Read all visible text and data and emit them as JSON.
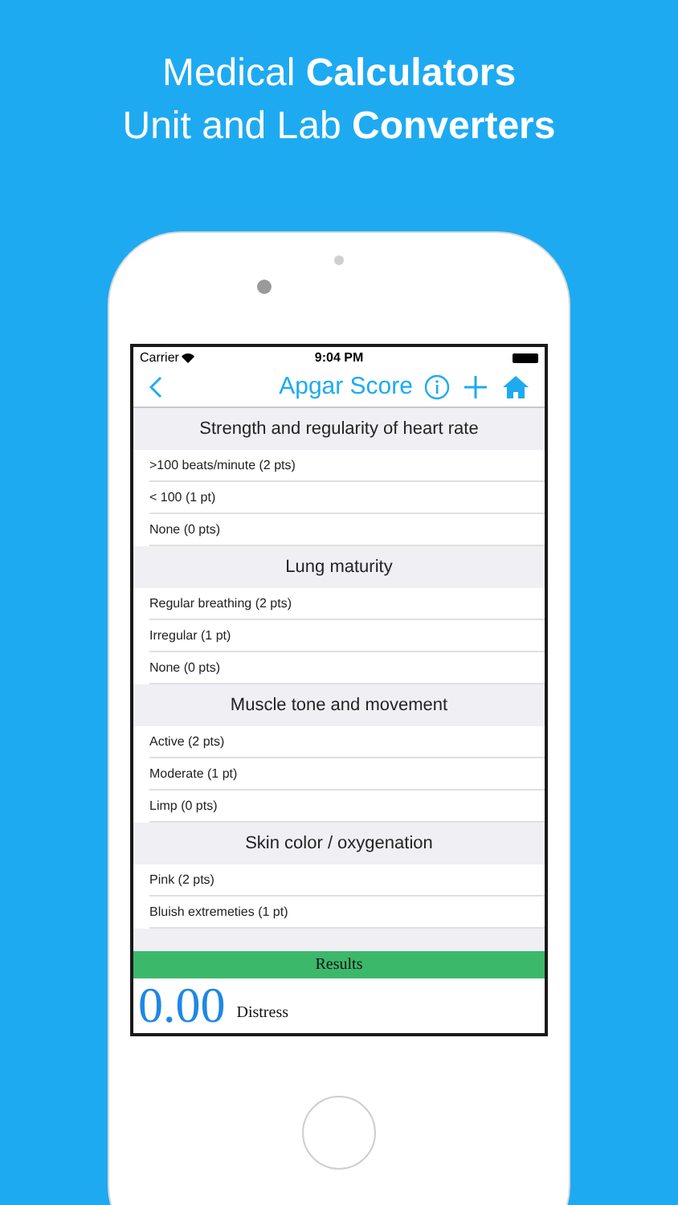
{
  "headline": [
    {
      "text": "Medical **Calculators**"
    },
    {
      "text": "Unit and Lab **Converters**"
    }
  ],
  "status_bar": {
    "carrier": "Carrier",
    "time": "9:04 PM"
  },
  "nav": {
    "title": "Apgar Score"
  },
  "sections": [
    {
      "title": "Strength and regularity of heart rate",
      "options": [
        ">100 beats/minute (2 pts)",
        "< 100 (1 pt)",
        "None (0 pts)"
      ]
    },
    {
      "title": "Lung maturity",
      "options": [
        "Regular breathing (2 pts)",
        "Irregular (1 pt)",
        "None (0 pts)"
      ]
    },
    {
      "title": "Muscle tone and movement",
      "options": [
        "Active (2 pts)",
        "Moderate (1 pt)",
        "Limp (0 pts)"
      ]
    },
    {
      "title": "Skin color / oxygenation",
      "options": [
        "Pink (2 pts)",
        "Bluish extremeties (1 pt)"
      ]
    }
  ],
  "results": {
    "header": "Results",
    "score": "0.00",
    "label": "Distress"
  }
}
